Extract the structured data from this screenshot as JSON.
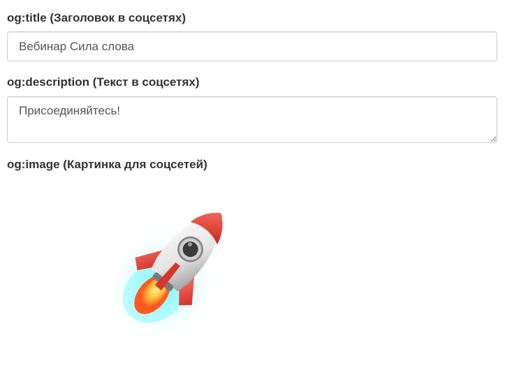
{
  "og_title": {
    "label": "og:title (Заголовок в соцсетях)",
    "value": "Вебинар Сила слова"
  },
  "og_description": {
    "label": "og:description (Текст в соцсетях)",
    "value": "Присоединяйтесь!"
  },
  "og_image": {
    "label": "og:image (Картинка для соцсетей)",
    "image": "rocket-emoji"
  },
  "colors": {
    "label_text": "#333333",
    "input_border": "#cccccc",
    "input_text": "#555555",
    "rocket_red": "#e8453c",
    "rocket_body": "#e6e6e6",
    "glow": "#2ff0ff",
    "flame": "#ffb52e"
  }
}
